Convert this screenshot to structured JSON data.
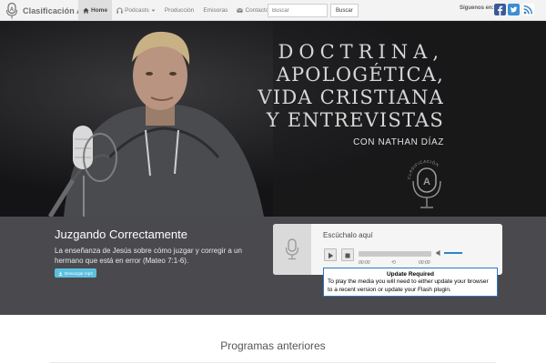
{
  "navbar": {
    "brand": "Clasificación A",
    "items": [
      {
        "label": "Home",
        "icon": "home-icon",
        "active": true
      },
      {
        "label": "Podcasts",
        "icon": "headphones-icon",
        "dropdown": true
      },
      {
        "label": "Producción"
      },
      {
        "label": "Emisoras"
      },
      {
        "label": "Contacto",
        "icon": "envelope-icon"
      }
    ],
    "search": {
      "placeholder": "Buscar",
      "button": "Buscar"
    },
    "follow_label": "Síguenos en:",
    "social": [
      {
        "name": "facebook-icon",
        "color": "#3b5998"
      },
      {
        "name": "twitter-icon",
        "color": "#3a8ed1"
      },
      {
        "name": "rss-icon",
        "color": "#3e86c6"
      }
    ]
  },
  "hero": {
    "lines": [
      "DOCTRINA,",
      "APOLOGÉTICA,",
      "VIDA CRISTIANA",
      "Y ENTREVISTAS"
    ],
    "byline": "CON NATHAN  DÍAZ",
    "mic_badge": "CLASIFICACIÓN"
  },
  "episode": {
    "title": "Juzgando Correctamente",
    "description": "La enseñanza de Jesús sobre cómo juzgar y corregir a un hermano que está en error (Mateo 7:1-6).",
    "download": "Descargar mp3"
  },
  "player": {
    "title": "Escúchalo aquí",
    "time_start": "00:00",
    "time_end": "00:00",
    "update_title": "Update Required",
    "update_body": "To play the media you will need to either update your browser to a recent version or update your Flash plugin."
  },
  "previous": {
    "title": "Programas anteriores"
  },
  "colors": {
    "accent": "#5bc0de",
    "player_border": "#2c78c0",
    "band": "#4a4a4e"
  }
}
